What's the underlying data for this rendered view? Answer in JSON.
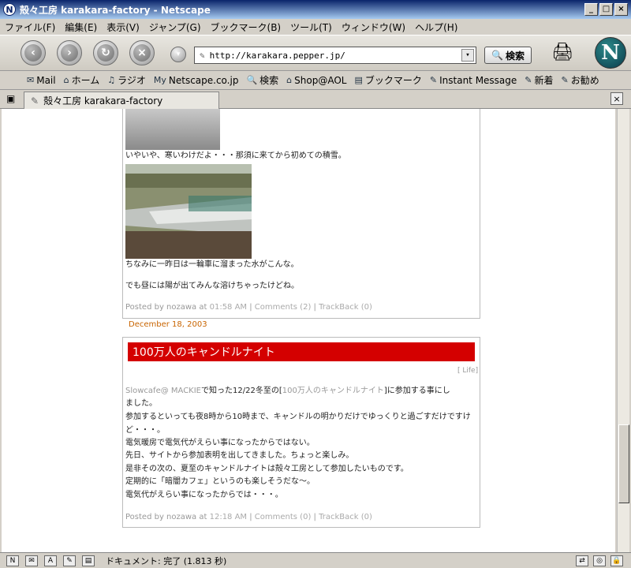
{
  "window": {
    "title": "殻々工房  karakara-factory - Netscape",
    "icon": "netscape-n-icon"
  },
  "menu": [
    "ファイル(F)",
    "編集(E)",
    "表示(V)",
    "ジャンプ(G)",
    "ブックマーク(B)",
    "ツール(T)",
    "ウィンドウ(W)",
    "ヘルプ(H)"
  ],
  "nav": {
    "url": "http://karakara.pepper.jp/",
    "search_label": "検索"
  },
  "bookmarks": [
    "Mail",
    "ホーム",
    "ラジオ",
    "Netscape.co.jp",
    "検索",
    "Shop@AOL",
    "ブックマーク",
    "Instant Message",
    "新着",
    "お勧め"
  ],
  "tab": {
    "title": "殻々工房  karakara-factory"
  },
  "post1": {
    "line1": "いやいや、寒いわけだよ・・・那須に来てから初めての積雪。",
    "line2": "ちなみに一昨日は一輪車に溜まった水がこんな。",
    "line3": "でも昼には陽が出てみんな溶けちゃったけどね。",
    "footer": {
      "posted": "Posted by nozawa at ",
      "time": "01:58 AM",
      "sep": " | ",
      "comments": "Comments (2)",
      "trackback": "TrackBack (0)"
    }
  },
  "date2": "December 18, 2003",
  "post2": {
    "title": "100万人のキャンドルナイト",
    "category": "[ Life]",
    "body_link1": "Slowcafe@ MACKIE",
    "body_mid1": "で知った12/22冬至の[",
    "body_link2": "100万人のキャンドルナイト",
    "body_end1": "]に参加する事にし",
    "lines": [
      "ました。",
      "参加するといっても夜8時から10時まで、キャンドルの明かりだけでゆっくりと過ごすだけですけ",
      "ど・・・。",
      "電気暖房で電気代がえらい事になったからではない。",
      "先日、サイトから参加表明を出してきました。ちょっと楽しみ。",
      "是非その次の、夏至のキャンドルナイトは殻々工房として参加したいものです。",
      "定期的に「暗闇カフェ」というのも楽しそうだな〜。",
      "電気代がえらい事になったからでは・・・。"
    ],
    "footer": {
      "posted": "Posted by nozawa at ",
      "time": "12:18 AM",
      "sep": " | ",
      "comments": "Comments (0)",
      "trackback": "TrackBack (0)"
    }
  },
  "status": {
    "text": "ドキュメント: 完了 (1.813 秒)"
  }
}
